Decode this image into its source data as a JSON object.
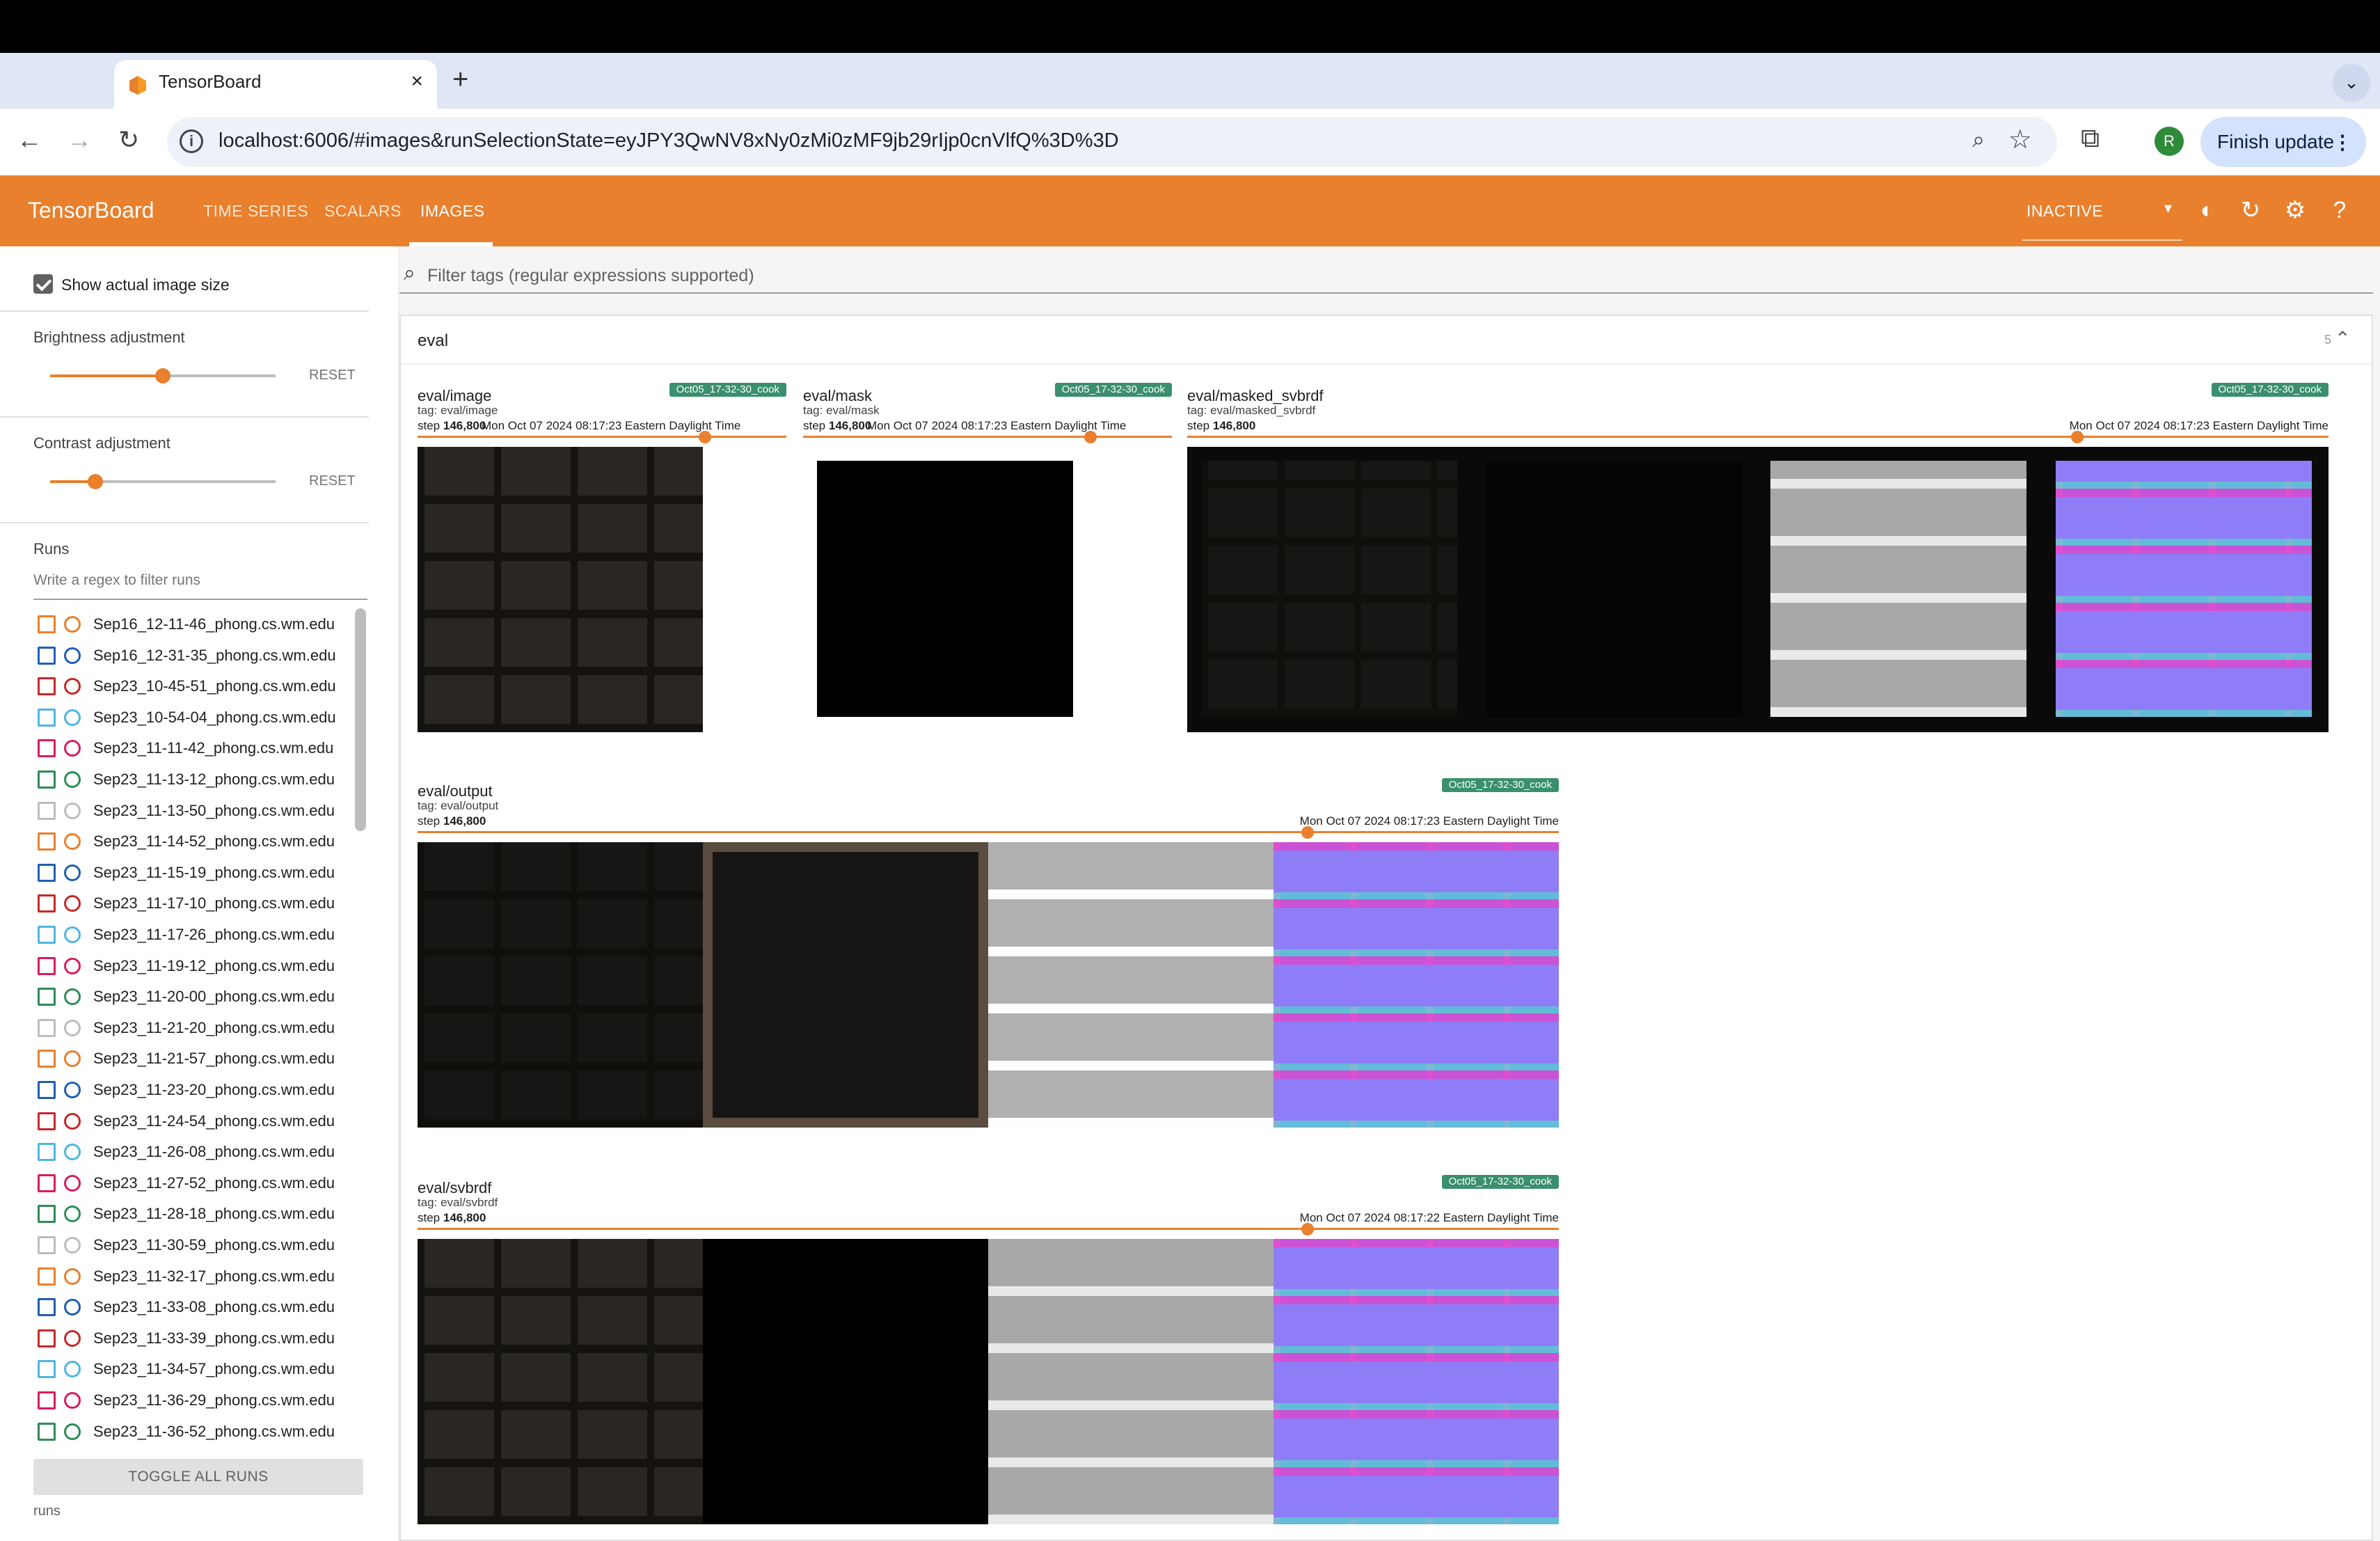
{
  "browser": {
    "tab_title": "TensorBoard",
    "tab_close": "×",
    "new_tab": "+",
    "url": "localhost:6006/#images&runSelectionState=eyJPY3QwNV8xNy0zMi0zMF9jb29rIjp0cnVlfQ%3D%3D",
    "profile_initial": "R",
    "update_label": "Finish update"
  },
  "header": {
    "brand": "TensorBoard",
    "tabs": [
      "TIME SERIES",
      "SCALARS",
      "IMAGES"
    ],
    "active_tab": "IMAGES",
    "status": "INACTIVE"
  },
  "sidebar": {
    "show_actual_size_label": "Show actual image size",
    "show_actual_size_checked": true,
    "brightness_label": "Brightness adjustment",
    "brightness_value": 0.5,
    "contrast_label": "Contrast adjustment",
    "contrast_value": 0.2,
    "reset_label": "RESET",
    "runs_label": "Runs",
    "runs_filter_placeholder": "Write a regex to filter runs",
    "runs": [
      {
        "name": "Sep16_12-11-46_phong.cs.wm.edu",
        "color": "#e8802d"
      },
      {
        "name": "Sep16_12-31-35_phong.cs.wm.edu",
        "color": "#1f5fb0"
      },
      {
        "name": "Sep23_10-45-51_phong.cs.wm.edu",
        "color": "#c62828"
      },
      {
        "name": "Sep23_10-54-04_phong.cs.wm.edu",
        "color": "#4fb6e0"
      },
      {
        "name": "Sep23_11-11-42_phong.cs.wm.edu",
        "color": "#d81b60"
      },
      {
        "name": "Sep23_11-13-12_phong.cs.wm.edu",
        "color": "#2e8b57"
      },
      {
        "name": "Sep23_11-13-50_phong.cs.wm.edu",
        "color": "#bdbdbd"
      },
      {
        "name": "Sep23_11-14-52_phong.cs.wm.edu",
        "color": "#e8802d"
      },
      {
        "name": "Sep23_11-15-19_phong.cs.wm.edu",
        "color": "#1f5fb0"
      },
      {
        "name": "Sep23_11-17-10_phong.cs.wm.edu",
        "color": "#c62828"
      },
      {
        "name": "Sep23_11-17-26_phong.cs.wm.edu",
        "color": "#4fb6e0"
      },
      {
        "name": "Sep23_11-19-12_phong.cs.wm.edu",
        "color": "#d81b60"
      },
      {
        "name": "Sep23_11-20-00_phong.cs.wm.edu",
        "color": "#2e8b57"
      },
      {
        "name": "Sep23_11-21-20_phong.cs.wm.edu",
        "color": "#bdbdbd"
      },
      {
        "name": "Sep23_11-21-57_phong.cs.wm.edu",
        "color": "#e8802d"
      },
      {
        "name": "Sep23_11-23-20_phong.cs.wm.edu",
        "color": "#1f5fb0"
      },
      {
        "name": "Sep23_11-24-54_phong.cs.wm.edu",
        "color": "#c62828"
      },
      {
        "name": "Sep23_11-26-08_phong.cs.wm.edu",
        "color": "#4fb6e0"
      },
      {
        "name": "Sep23_11-27-52_phong.cs.wm.edu",
        "color": "#d81b60"
      },
      {
        "name": "Sep23_11-28-18_phong.cs.wm.edu",
        "color": "#2e8b57"
      },
      {
        "name": "Sep23_11-30-59_phong.cs.wm.edu",
        "color": "#bdbdbd"
      },
      {
        "name": "Sep23_11-32-17_phong.cs.wm.edu",
        "color": "#e8802d"
      },
      {
        "name": "Sep23_11-33-08_phong.cs.wm.edu",
        "color": "#1f5fb0"
      },
      {
        "name": "Sep23_11-33-39_phong.cs.wm.edu",
        "color": "#c62828"
      },
      {
        "name": "Sep23_11-34-57_phong.cs.wm.edu",
        "color": "#4fb6e0"
      },
      {
        "name": "Sep23_11-36-29_phong.cs.wm.edu",
        "color": "#d81b60"
      },
      {
        "name": "Sep23_11-36-52_phong.cs.wm.edu",
        "color": "#2e8b57"
      }
    ],
    "toggle_all_label": "TOGGLE ALL RUNS",
    "footer": "runs"
  },
  "main": {
    "filter_placeholder": "Filter tags (regular expressions supported)",
    "group": {
      "title": "eval",
      "count": "5"
    },
    "cards": [
      {
        "title": "eval/image",
        "tag": "tag: eval/image",
        "step_prefix": "step ",
        "step": "146,800",
        "time": "Mon Oct 07 2024 08:17:23 Eastern Daylight Time",
        "run": "Oct05_17-32-30_cook",
        "slider": 0.78
      },
      {
        "title": "eval/mask",
        "tag": "tag: eval/mask",
        "step_prefix": "step ",
        "step": "146,800",
        "time": "Mon Oct 07 2024 08:17:23 Eastern Daylight Time",
        "run": "Oct05_17-32-30_cook",
        "slider": 0.78
      },
      {
        "title": "eval/masked_svbrdf",
        "tag": "tag: eval/masked_svbrdf",
        "step_prefix": "step ",
        "step": "146,800",
        "time": "Mon Oct 07 2024 08:17:23 Eastern Daylight Time",
        "run": "Oct05_17-32-30_cook",
        "slider": 0.78
      },
      {
        "title": "eval/output",
        "tag": "tag: eval/output",
        "step_prefix": "step ",
        "step": "146,800",
        "time": "Mon Oct 07 2024 08:17:23 Eastern Daylight Time",
        "run": "Oct05_17-32-30_cook",
        "slider": 0.78
      },
      {
        "title": "eval/svbrdf",
        "tag": "tag: eval/svbrdf",
        "step_prefix": "step ",
        "step": "146,800",
        "time": "Mon Oct 07 2024 08:17:22 Eastern Daylight Time",
        "run": "Oct05_17-32-30_cook",
        "slider": 0.78
      }
    ]
  }
}
